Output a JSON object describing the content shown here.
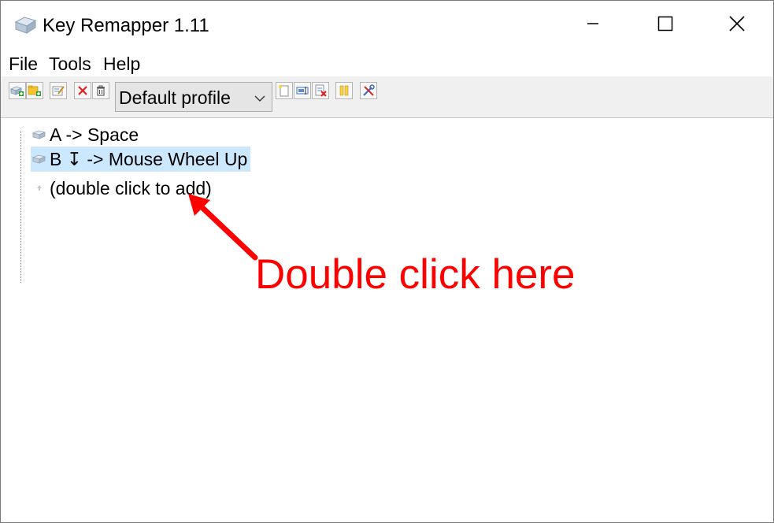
{
  "window": {
    "title": "Key Remapper 1.11",
    "app_icon": "keyboard-key-icon"
  },
  "menu": {
    "items": [
      "File",
      "Tools",
      "Help"
    ]
  },
  "toolbar": {
    "profile_value": "Default profile",
    "icons": [
      "add-key-icon",
      "add-folder-icon",
      "edit-icon",
      "delete-icon",
      "trash-icon",
      "new-profile-icon",
      "rename-profile-icon",
      "delete-profile-icon",
      "pause-icon",
      "settings-tools-icon"
    ]
  },
  "tree": {
    "items": [
      {
        "label": "A -> Space",
        "icon": "key-icon",
        "selected": false
      },
      {
        "label": "B ↧ -> Mouse Wheel Up",
        "icon": "key-icon",
        "selected": true
      },
      {
        "label": "(double click to add)",
        "icon": "add-small-icon",
        "selected": false
      }
    ]
  },
  "annotation": {
    "text": "Double click here",
    "color": "#ff0000"
  },
  "colors": {
    "selection": "#cce8ff",
    "toolbar_bg": "#f0f0f0"
  }
}
